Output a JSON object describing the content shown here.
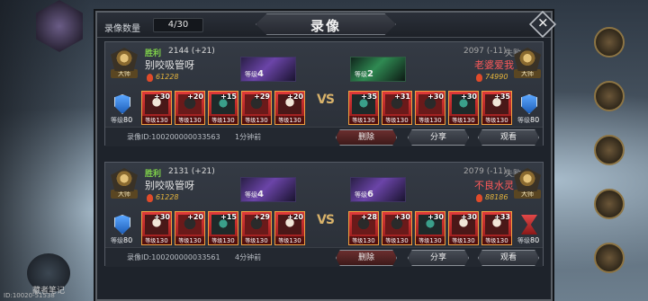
{
  "footer_id": "ID:10020-51538",
  "background": {
    "bottom_left_label": "藏者笔记"
  },
  "modal": {
    "title": "录像",
    "count_label": "录像数量",
    "count_value": "4/30",
    "close_icon": "close-x-icon"
  },
  "records": [
    {
      "left": {
        "result": "胜利",
        "score": "2144 (+21)",
        "name": "别咬吸管呀",
        "power": "61228",
        "rank": "大师",
        "pet_level_label": "等级",
        "pet_level": "4",
        "side_icon": "shield-icon",
        "side_level_label": "等级",
        "side_level": "80",
        "heroes": [
          {
            "plus": "+30",
            "level_label": "等级",
            "level": "130"
          },
          {
            "plus": "+20",
            "level_label": "等级",
            "level": "130"
          },
          {
            "plus": "+15",
            "level_label": "等级",
            "level": "130"
          },
          {
            "plus": "+29",
            "level_label": "等级",
            "level": "130"
          },
          {
            "plus": "+20",
            "level_label": "等级",
            "level": "130"
          }
        ]
      },
      "right": {
        "result": "失败",
        "score": "2097 (-11)",
        "name": "老婆爱我",
        "power": "74990",
        "rank": "大师",
        "pet_level_label": "等级",
        "pet_level": "2",
        "side_icon": "shield-icon",
        "side_level_label": "等级",
        "side_level": "80",
        "heroes": [
          {
            "plus": "+35",
            "level_label": "等级",
            "level": "130"
          },
          {
            "plus": "+31",
            "level_label": "等级",
            "level": "130"
          },
          {
            "plus": "+30",
            "level_label": "等级",
            "level": "130"
          },
          {
            "plus": "+30",
            "level_label": "等级",
            "level": "130"
          },
          {
            "plus": "+35",
            "level_label": "等级",
            "level": "130"
          }
        ]
      },
      "vs": "VS",
      "record_id": "录像ID:100200000033563",
      "time": "1分钟前",
      "buttons": {
        "delete": "删除",
        "share": "分享",
        "watch": "观看"
      }
    },
    {
      "left": {
        "result": "胜利",
        "score": "2131 (+21)",
        "name": "别咬吸管呀",
        "power": "61228",
        "rank": "大师",
        "pet_level_label": "等级",
        "pet_level": "4",
        "side_icon": "shield-icon",
        "side_level_label": "等级",
        "side_level": "80",
        "heroes": [
          {
            "plus": "+30",
            "level_label": "等级",
            "level": "130"
          },
          {
            "plus": "+20",
            "level_label": "等级",
            "level": "130"
          },
          {
            "plus": "+15",
            "level_label": "等级",
            "level": "130"
          },
          {
            "plus": "+29",
            "level_label": "等级",
            "level": "130"
          },
          {
            "plus": "+20",
            "level_label": "等级",
            "level": "130"
          }
        ]
      },
      "right": {
        "result": "失败",
        "score": "2079 (-11)",
        "name": "不良水灵",
        "power": "88186",
        "rank": "大师",
        "pet_level_label": "等级",
        "pet_level": "6",
        "side_icon": "hourglass-icon",
        "side_level_label": "等级",
        "side_level": "80",
        "heroes": [
          {
            "plus": "+28",
            "level_label": "等级",
            "level": "130"
          },
          {
            "plus": "+30",
            "level_label": "等级",
            "level": "130"
          },
          {
            "plus": "+30",
            "level_label": "等级",
            "level": "130"
          },
          {
            "plus": "+30",
            "level_label": "等级",
            "level": "130"
          },
          {
            "plus": "+33",
            "level_label": "等级",
            "level": "130"
          }
        ]
      },
      "vs": "VS",
      "record_id": "录像ID:100200000033561",
      "time": "4分钟前",
      "buttons": {
        "delete": "删除",
        "share": "分享",
        "watch": "观看"
      }
    }
  ]
}
